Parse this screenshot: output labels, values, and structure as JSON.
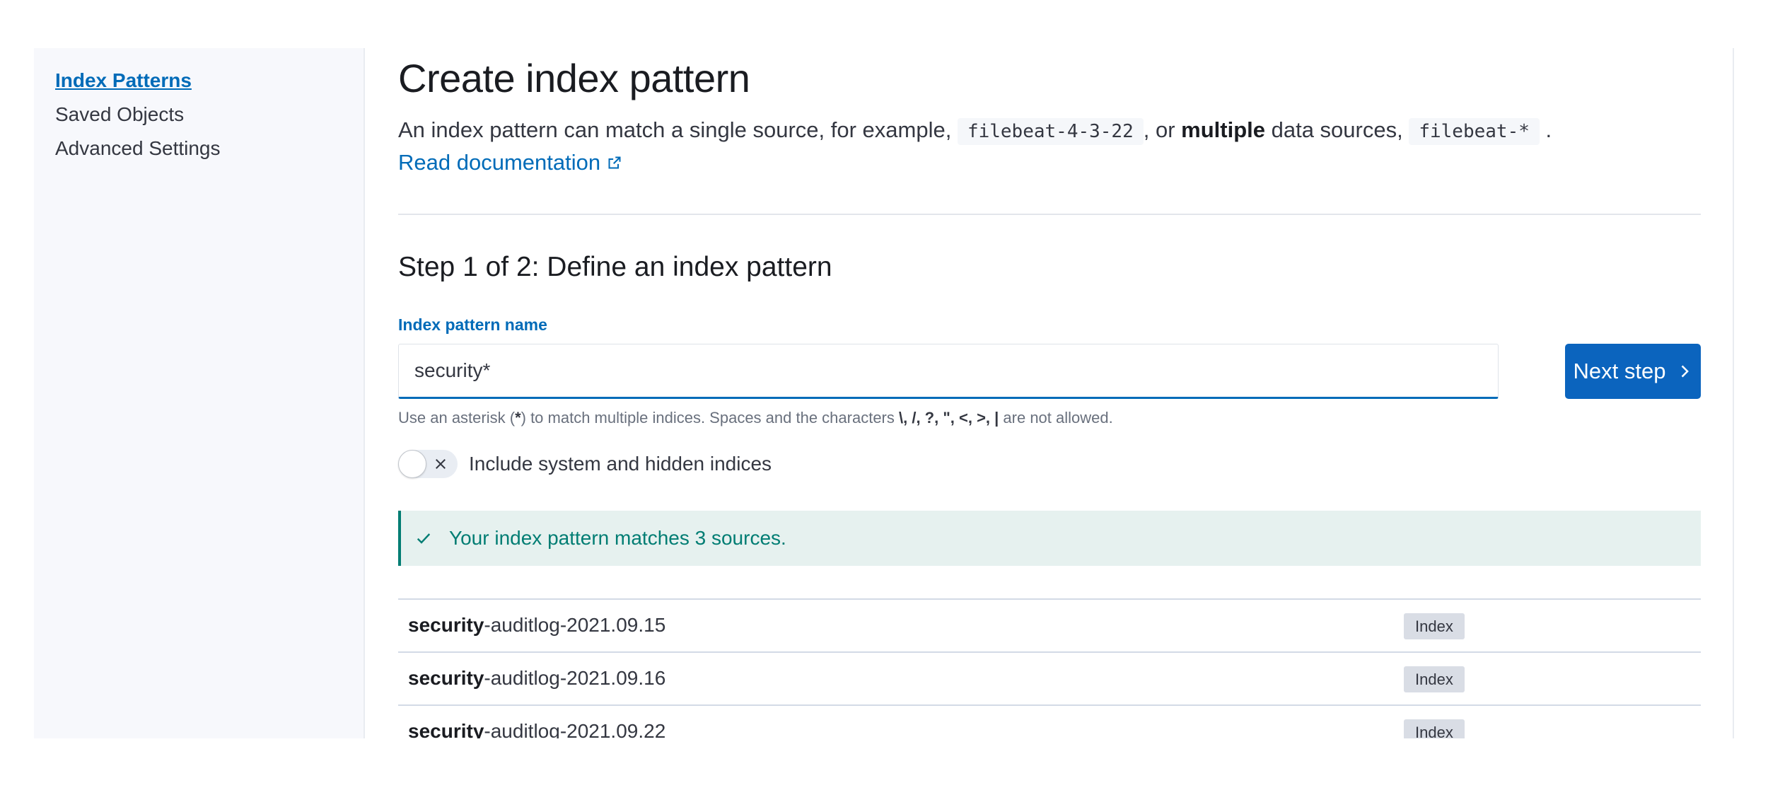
{
  "sidebar": {
    "items": [
      {
        "label": "Index Patterns",
        "active": true
      },
      {
        "label": "Saved Objects",
        "active": false
      },
      {
        "label": "Advanced Settings",
        "active": false
      }
    ]
  },
  "header": {
    "title": "Create index pattern",
    "description_parts": {
      "p1": "An index pattern can match a single source, for example, ",
      "code1": "filebeat-4-3-22",
      "p2": ", or ",
      "bold": "multiple",
      "p3": " data sources, ",
      "code2": "filebeat-*",
      "p4": " ."
    },
    "doc_link": "Read documentation"
  },
  "step": {
    "title": "Step 1 of 2: Define an index pattern",
    "field_label": "Index pattern name",
    "input_value": "security*",
    "next_button": "Next step",
    "help": {
      "pre": "Use an asterisk (",
      "star": "*",
      "mid": ") to match multiple indices. Spaces and the characters ",
      "chars": "\\, /, ?, \", <, >, |",
      "post": " are not allowed."
    },
    "toggle_label": "Include system and hidden indices",
    "toggle_on": false
  },
  "callout": {
    "text": "Your index pattern matches 3 sources."
  },
  "results": {
    "rows": [
      {
        "match": "security",
        "rest": "-auditlog-2021.09.15",
        "badge": "Index"
      },
      {
        "match": "security",
        "rest": "-auditlog-2021.09.16",
        "badge": "Index"
      },
      {
        "match": "security",
        "rest": "-auditlog-2021.09.22",
        "badge": "Index"
      }
    ]
  },
  "colors": {
    "link": "#006bb8",
    "primary_button": "#0b64be",
    "success_text": "#017d73",
    "success_bg": "#e6f1ef"
  }
}
